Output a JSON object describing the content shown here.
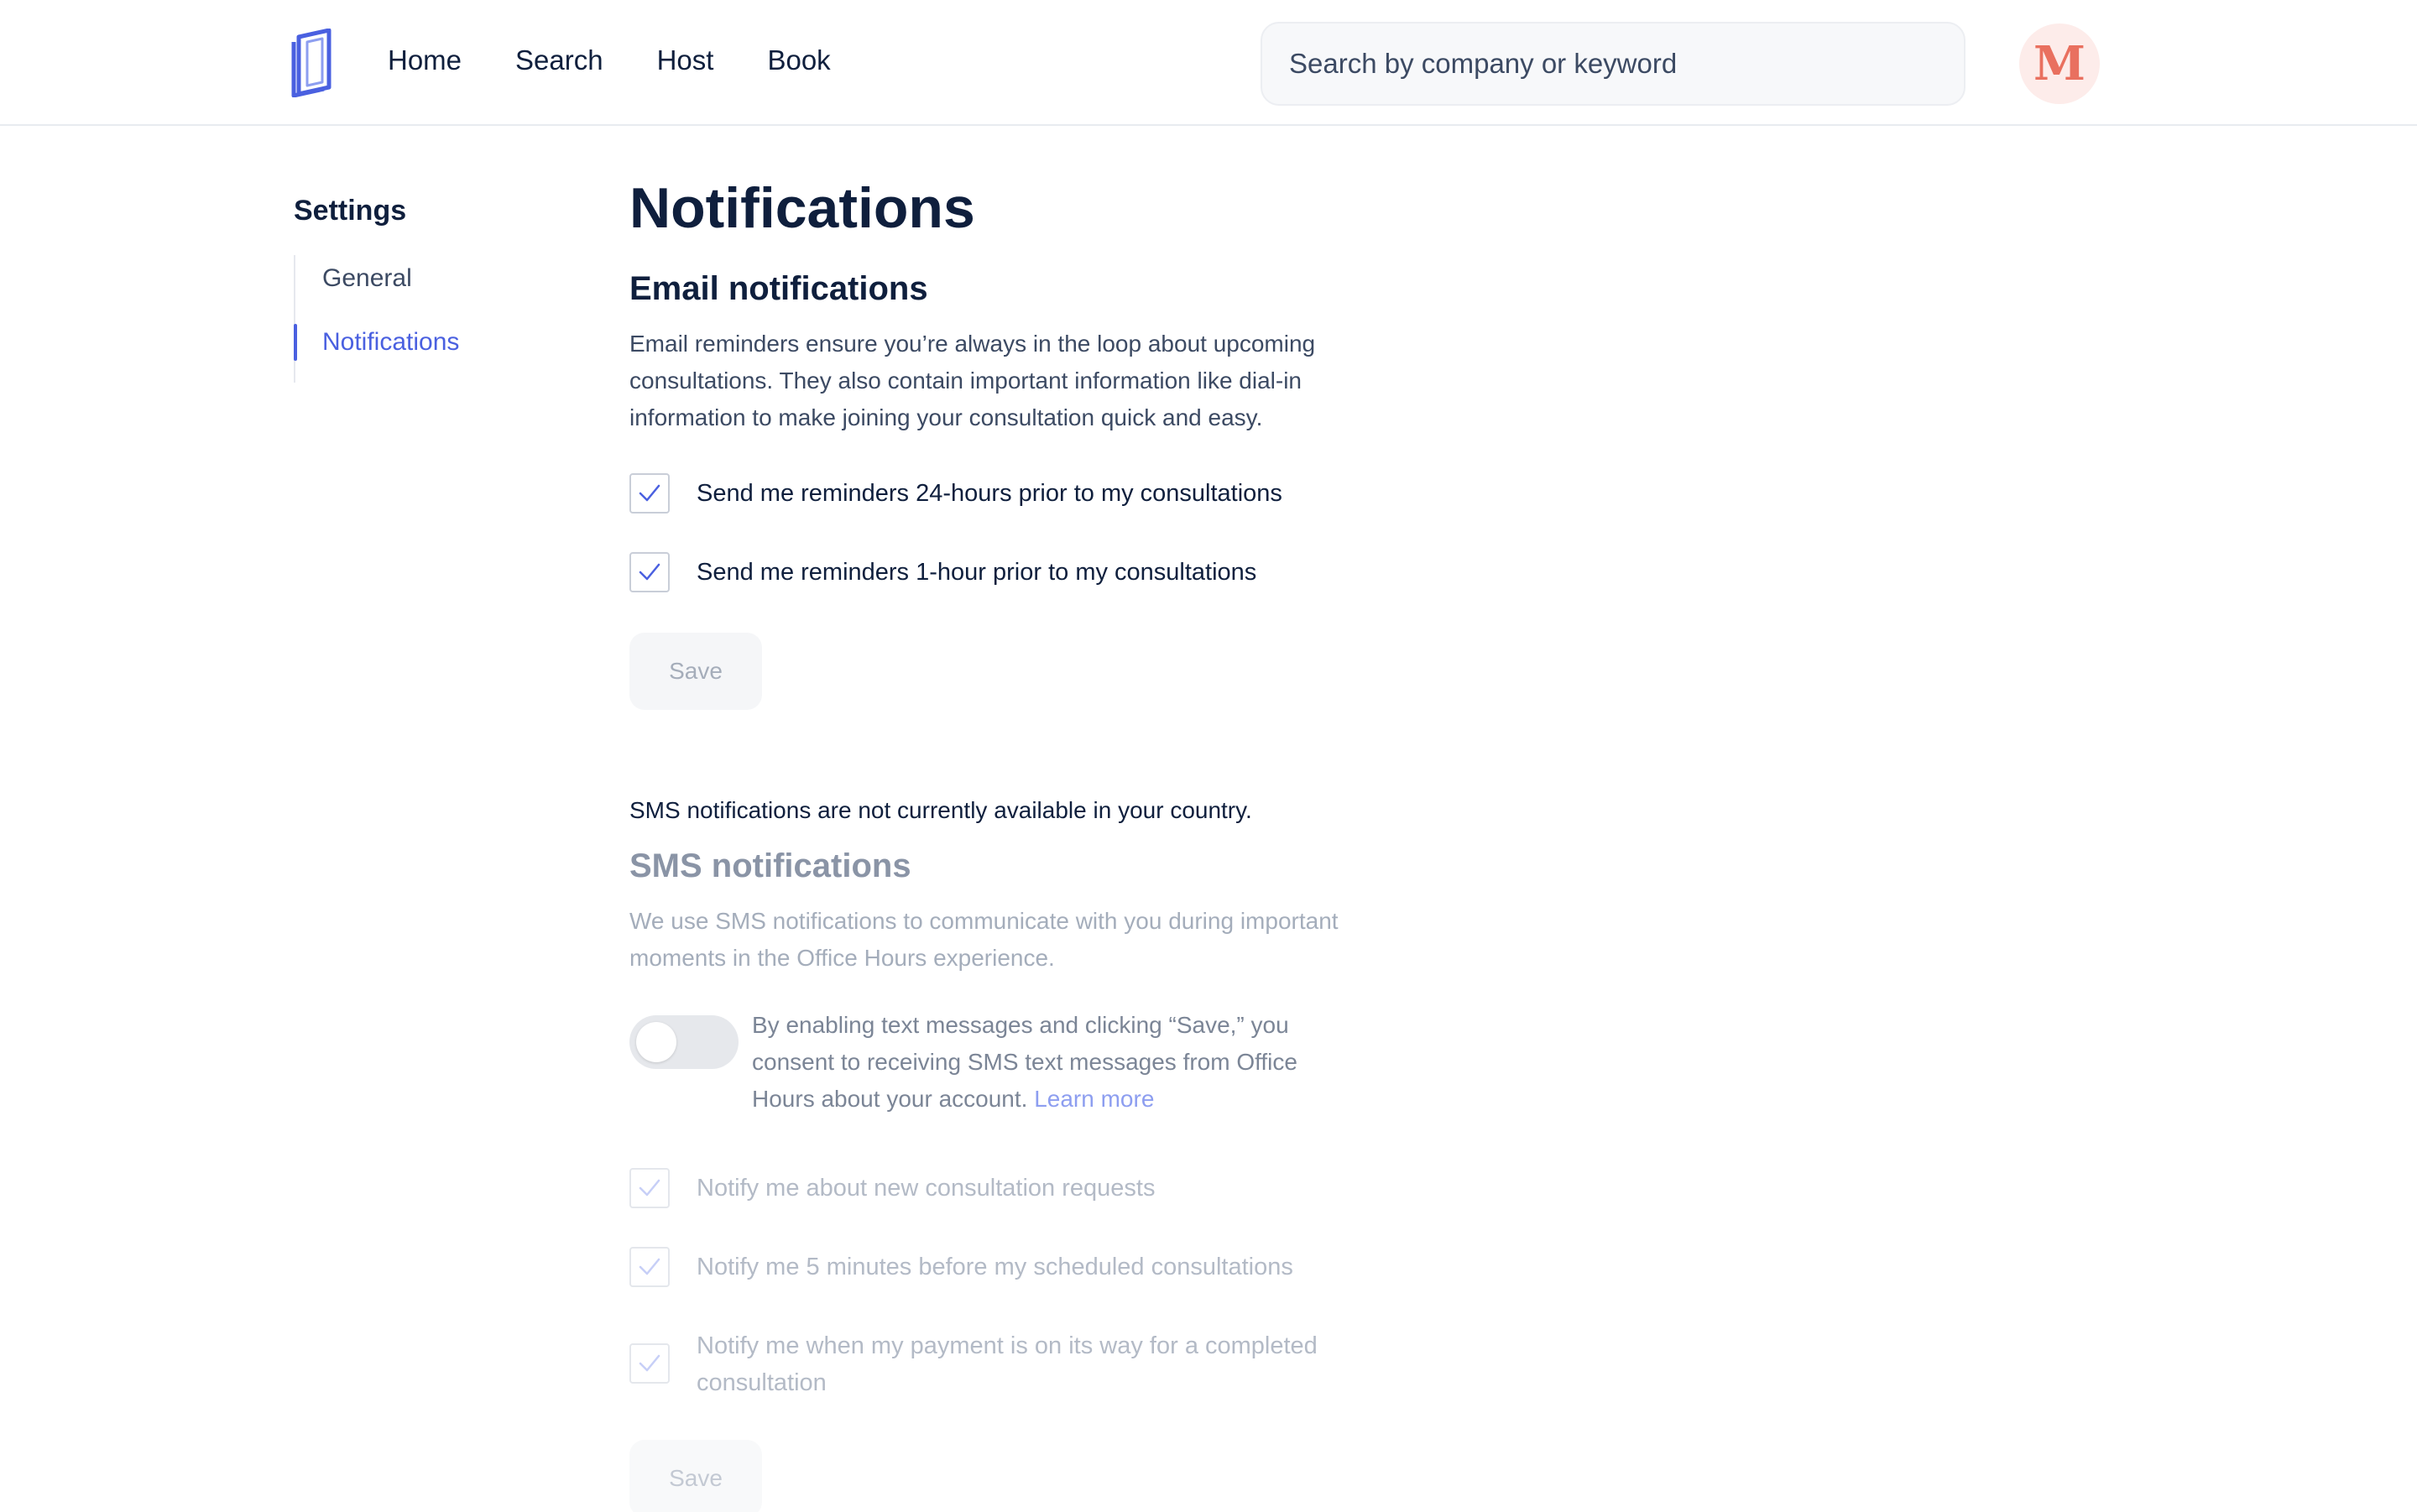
{
  "header": {
    "logo_icon": "book-logo-icon",
    "nav": [
      "Home",
      "Search",
      "Host",
      "Book"
    ],
    "search_placeholder": "Search by company or keyword",
    "avatar_letter": "M",
    "accent_color": "#4a60e0"
  },
  "sidebar": {
    "title": "Settings",
    "items": [
      {
        "label": "General",
        "active": false
      },
      {
        "label": "Notifications",
        "active": true
      }
    ]
  },
  "main": {
    "title": "Notifications",
    "email": {
      "title": "Email notifications",
      "description": "Email reminders ensure you’re always in the loop about upcoming consultations. They also contain important information like dial-in information to make joining your consultation quick and easy.",
      "options": [
        {
          "label": "Send me reminders 24-hours prior to my consultations",
          "checked": true
        },
        {
          "label": "Send me reminders 1-hour prior to my consultations",
          "checked": true
        }
      ],
      "save_label": "Save"
    },
    "sms": {
      "notice": "SMS notifications are not currently available in your country.",
      "title": "SMS notifications",
      "description": "We use SMS notifications to communicate with you during important moments in the Office Hours experience.",
      "toggle_enabled": false,
      "consent_text": "By enabling text messages and clicking “Save,” you consent to receiving SMS text messages from Office Hours about your account.",
      "learn_more": "Learn more",
      "options": [
        {
          "label": "Notify me about new consultation requests",
          "checked": true
        },
        {
          "label": "Notify me 5 minutes before my scheduled consultations",
          "checked": true
        },
        {
          "label": "Notify me when my payment is on its way for a completed consultation",
          "checked": true
        }
      ],
      "save_label": "Save"
    }
  }
}
